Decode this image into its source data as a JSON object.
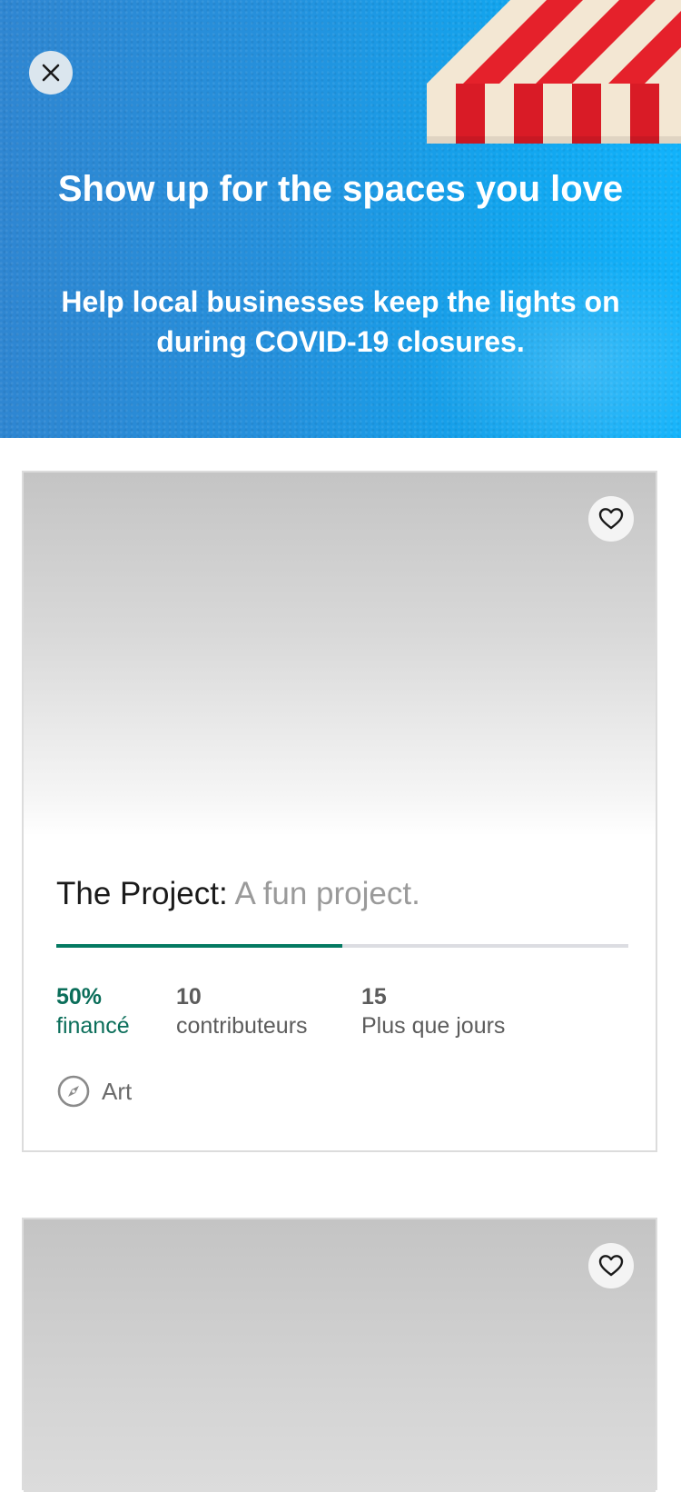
{
  "header": {
    "title": "Show up for the spaces you love",
    "subtitle": "Help local businesses keep the lights on during COVID-19 closures.",
    "close_icon": "close-icon",
    "colors": {
      "gradient_start": "#2f86d1",
      "gradient_end": "#12b3fb",
      "text": "#ffffff"
    }
  },
  "projects": [
    {
      "name": "The Project:",
      "blurb": "A fun project.",
      "funded_pct": 0.5,
      "funded_value": "50%",
      "funded_label": "financé",
      "backers_value": "10",
      "backers_label": "contributeurs",
      "days_value": "15",
      "days_label": "Plus que jours",
      "category": "Art",
      "category_icon": "compass-icon",
      "favorite_icon": "heart-icon"
    },
    {
      "favorite_icon": "heart-icon"
    }
  ],
  "colors": {
    "funded": "#057a62",
    "track": "#dcdde2"
  }
}
